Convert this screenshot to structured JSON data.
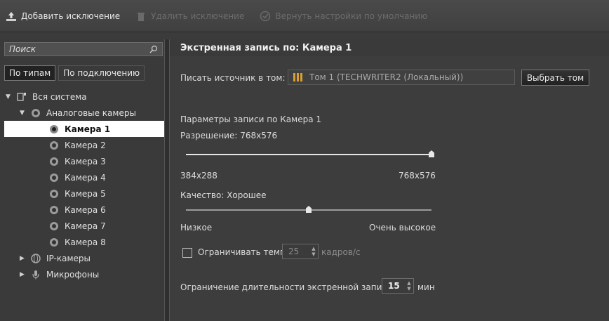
{
  "toolbar": {
    "add_label": "Добавить исключение",
    "delete_label": "Удалить исключение",
    "restore_label": "Вернуть настройки по умолчанию"
  },
  "search": {
    "placeholder": "Поиск"
  },
  "tabs": [
    {
      "label": "По типам",
      "active": true
    },
    {
      "label": "По подключению",
      "active": false
    }
  ],
  "tree": [
    {
      "label": "Вся система",
      "icon": "system-icon",
      "level": 0,
      "expanded": true
    },
    {
      "label": "Аналоговые камеры",
      "icon": "camera-group-icon",
      "level": 1,
      "expanded": true
    },
    {
      "label": "Камера 1",
      "icon": "camera-icon",
      "level": 2,
      "selected": true
    },
    {
      "label": "Камера 2",
      "icon": "camera-icon",
      "level": 2
    },
    {
      "label": "Камера 3",
      "icon": "camera-icon",
      "level": 2
    },
    {
      "label": "Камера 4",
      "icon": "camera-icon",
      "level": 2
    },
    {
      "label": "Камера 5",
      "icon": "camera-icon",
      "level": 2
    },
    {
      "label": "Камера 6",
      "icon": "camera-icon",
      "level": 2
    },
    {
      "label": "Камера 7",
      "icon": "camera-icon",
      "level": 2
    },
    {
      "label": "Камера 8",
      "icon": "camera-icon",
      "level": 2
    },
    {
      "label": "IP-камеры",
      "icon": "ip-camera-icon",
      "level": 1,
      "expanded": false
    },
    {
      "label": "Микрофоны",
      "icon": "microphone-icon",
      "level": 1,
      "expanded": false
    }
  ],
  "panel": {
    "title": "Экстренная запись по: Камера 1",
    "source_label": "Писать источник в том:",
    "source_value": "Том 1 (TECHWRITER2 (Локальный))",
    "select_button": "Выбрать том",
    "params_label": "Параметры записи по Камера 1",
    "resolution_label": "Разрешение: 768x576",
    "resolution_min": "384x288",
    "resolution_max": "768x576",
    "resolution_level": 1.0,
    "quality_label": "Качество: Хорошее",
    "quality_min": "Низкое",
    "quality_max": "Очень высокое",
    "quality_level": 0.5,
    "limit_rate_label": "Ограничивать темп",
    "limit_rate_checked": false,
    "rate_value": "25",
    "rate_unit": "кадров/с",
    "duration_label": "Ограничение длительности экстренной записи",
    "duration_value": "15",
    "duration_unit": "мин"
  },
  "colors": {
    "background": "#3b3b3b",
    "selected_row": "#ffffff",
    "text": "#d8d8d8"
  }
}
